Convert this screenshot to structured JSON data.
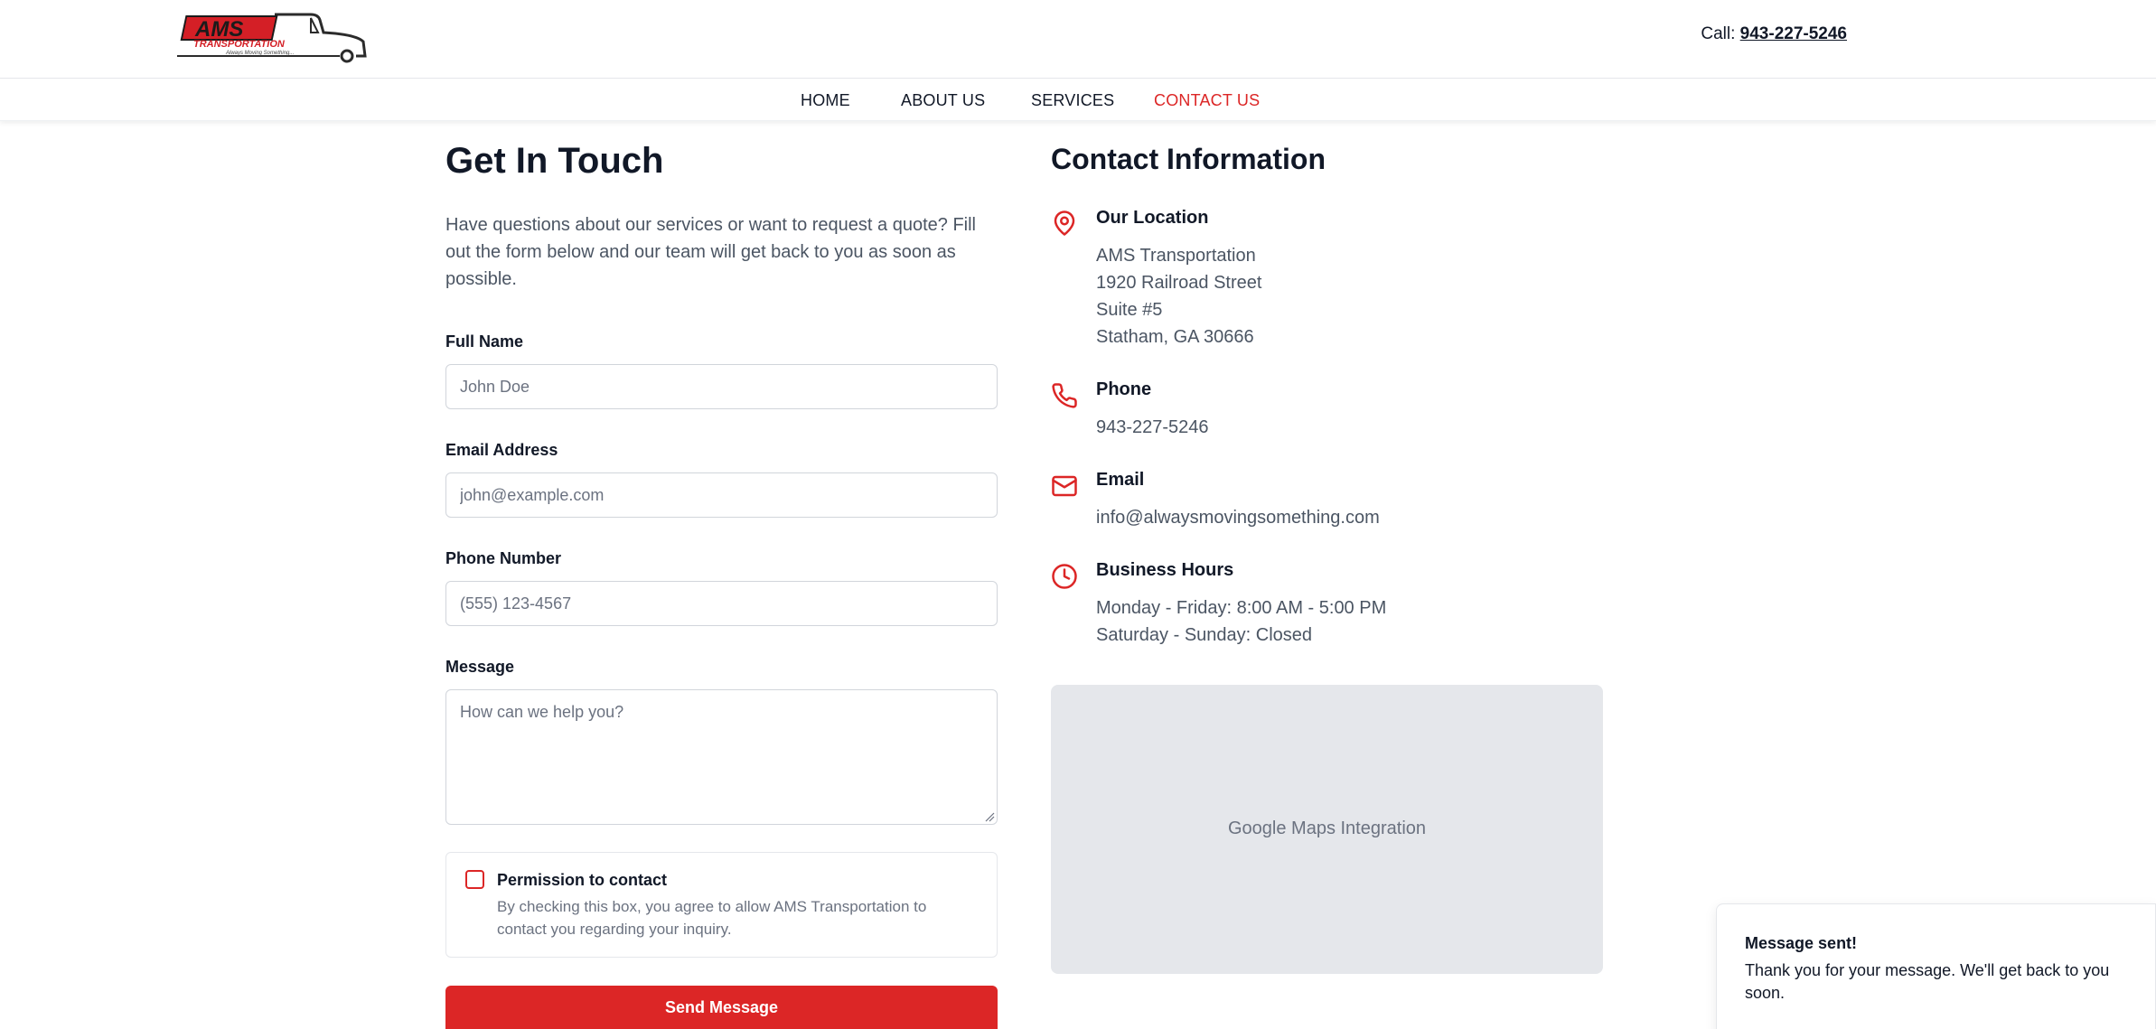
{
  "header": {
    "logo": {
      "wordmark": "AMS",
      "subword": "TRANSPORTATION",
      "tagline": "Always Moving Something..."
    },
    "call_label": "Call:",
    "call_number": "943-227-5246"
  },
  "nav": {
    "items": [
      {
        "label": "HOME",
        "active": false
      },
      {
        "label": "ABOUT US",
        "active": false
      },
      {
        "label": "SERVICES",
        "active": false
      },
      {
        "label": "CONTACT US",
        "active": true
      }
    ]
  },
  "form": {
    "title": "Get In Touch",
    "intro_lines": [
      "Have questions about our services or want to request a quote? Fill",
      "out the form below and our team will get back to you as soon as",
      "possible."
    ],
    "full_name": {
      "label": "Full Name",
      "placeholder": "John Doe",
      "value": ""
    },
    "email": {
      "label": "Email Address",
      "placeholder": "john@example.com",
      "value": ""
    },
    "phone": {
      "label": "Phone Number",
      "placeholder": "(555) 123-4567",
      "value": ""
    },
    "message": {
      "label": "Message",
      "placeholder": "How can we help you?",
      "value": ""
    },
    "permission": {
      "title": "Permission to contact",
      "description_lines": [
        "By checking this box, you agree to allow AMS Transportation to",
        "contact you regarding your inquiry."
      ],
      "checked": false
    },
    "submit_label": "Send Message"
  },
  "contact": {
    "title": "Contact Information",
    "location": {
      "heading": "Our Location",
      "lines": [
        "AMS Transportation",
        "1920 Railroad Street",
        "Suite #5",
        "Statham, GA 30666"
      ],
      "icon": "map-pin-icon"
    },
    "phone": {
      "heading": "Phone",
      "value": "943-227-5246",
      "icon": "phone-icon"
    },
    "email": {
      "heading": "Email",
      "value": "info@alwaysmovingsomething.com",
      "icon": "mail-icon"
    },
    "hours": {
      "heading": "Business Hours",
      "lines": [
        "Monday - Friday: 8:00 AM - 5:00 PM",
        "Saturday - Sunday: Closed"
      ],
      "icon": "clock-icon"
    },
    "map_label": "Google Maps Integration"
  },
  "toast": {
    "title": "Message sent!",
    "message": "Thank you for your message. We'll get back to you soon."
  },
  "colors": {
    "accent": "#dc2626",
    "text": "#111827",
    "muted": "#4b5563",
    "map_bg": "#e5e7eb"
  }
}
